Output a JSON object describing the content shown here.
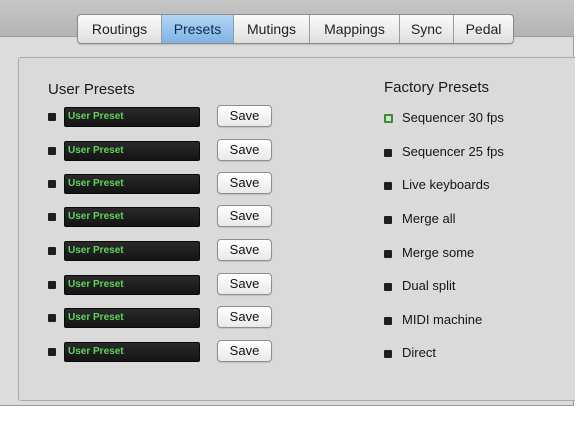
{
  "tabs": [
    {
      "label": "Routings"
    },
    {
      "label": "Presets",
      "active": true
    },
    {
      "label": "Mutings"
    },
    {
      "label": "Mappings"
    },
    {
      "label": "Sync"
    },
    {
      "label": "Pedal"
    }
  ],
  "user_presets": {
    "heading": "User Presets",
    "save_label": "Save",
    "items": [
      {
        "name": "User Preset"
      },
      {
        "name": "User Preset"
      },
      {
        "name": "User Preset"
      },
      {
        "name": "User Preset"
      },
      {
        "name": "User Preset"
      },
      {
        "name": "User Preset"
      },
      {
        "name": "User Preset"
      },
      {
        "name": "User Preset"
      }
    ]
  },
  "factory_presets": {
    "heading": "Factory Presets",
    "items": [
      {
        "label": "Sequencer 30 fps",
        "selected": true
      },
      {
        "label": "Sequencer 25 fps",
        "selected": false
      },
      {
        "label": "Live keyboards",
        "selected": false
      },
      {
        "label": "Merge all",
        "selected": false
      },
      {
        "label": "Merge some",
        "selected": false
      },
      {
        "label": "Dual split",
        "selected": false
      },
      {
        "label": "MIDI machine",
        "selected": false
      },
      {
        "label": "Direct",
        "selected": false
      }
    ]
  },
  "colors": {
    "active_tab": "#7fb2e4",
    "preset_text": "#5fd45c",
    "selected_led": "#3d8a3b"
  }
}
